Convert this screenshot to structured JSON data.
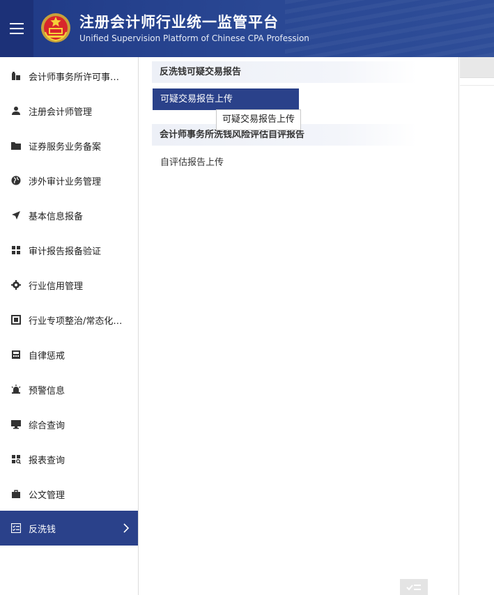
{
  "header": {
    "title_cn": "注册会计师行业统一监管平台",
    "title_en": "Unified Supervision Platform of Chinese CPA Profession"
  },
  "sidebar": {
    "items": [
      {
        "label": "会计师事务所许可事…",
        "icon": "building-icon"
      },
      {
        "label": "注册会计师管理",
        "icon": "user-icon"
      },
      {
        "label": "证券服务业务备案",
        "icon": "folder-icon"
      },
      {
        "label": "涉外审计业务管理",
        "icon": "globe-icon"
      },
      {
        "label": "基本信息报备",
        "icon": "paper-plane-icon"
      },
      {
        "label": "审计报告报备验证",
        "icon": "grid-icon"
      },
      {
        "label": "行业信用管理",
        "icon": "gear-icon"
      },
      {
        "label": "行业专项整治/常态化…",
        "icon": "square-frame-icon"
      },
      {
        "label": "自律惩戒",
        "icon": "calculator-icon"
      },
      {
        "label": "预警信息",
        "icon": "alarm-icon"
      },
      {
        "label": "综合查询",
        "icon": "monitor-icon"
      },
      {
        "label": "报表查询",
        "icon": "grid-search-icon"
      },
      {
        "label": "公文管理",
        "icon": "briefcase-icon"
      },
      {
        "label": "反洗钱",
        "icon": "checklist-icon",
        "active": true
      }
    ]
  },
  "panel": {
    "groups": [
      {
        "title": "反洗钱可疑交易报告",
        "links": [
          "可疑交易报告上传"
        ]
      },
      {
        "title": "会计师事务所洗钱风险评估自评报告",
        "links": [
          "自评估报告上传"
        ]
      }
    ],
    "tooltip": "可疑交易报告上传"
  },
  "colors": {
    "header": "#2a4894",
    "accent": "#2a418a",
    "panel_title_bg": "#edf0f7"
  }
}
